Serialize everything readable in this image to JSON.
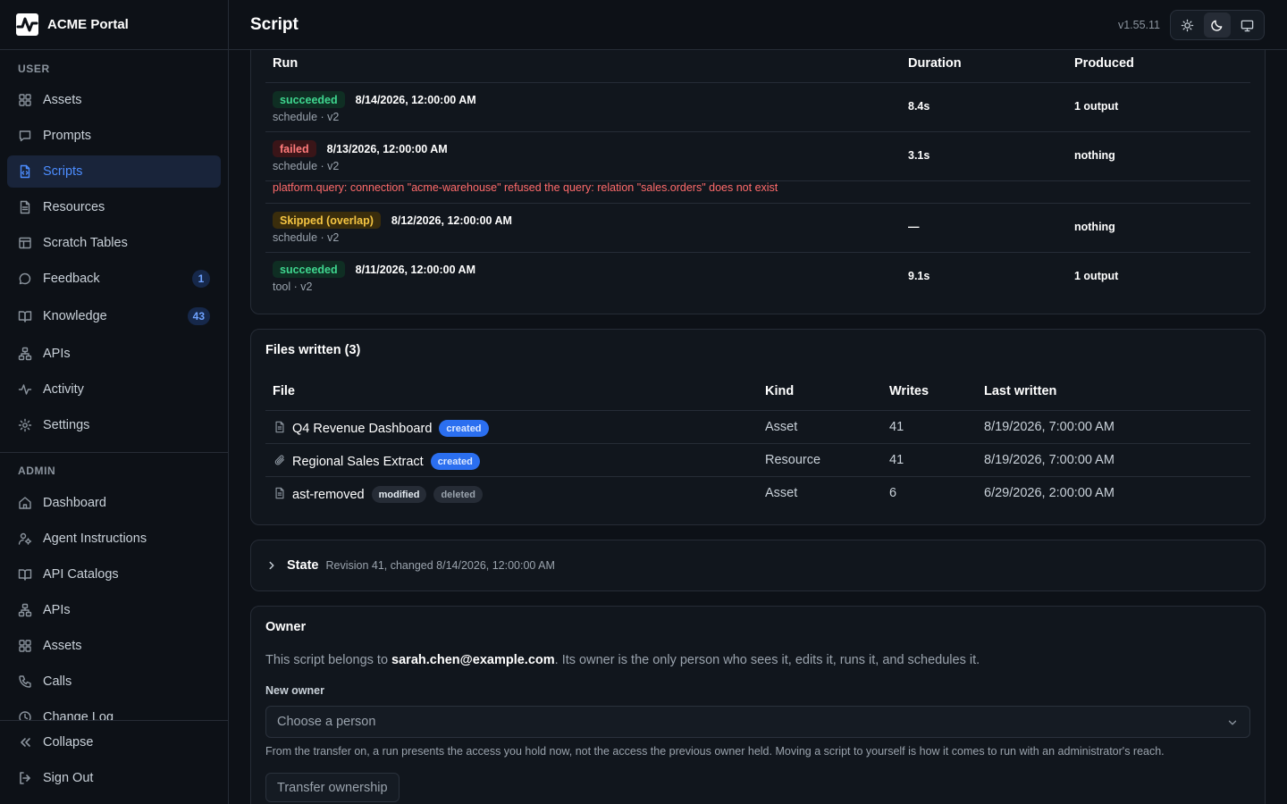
{
  "app": {
    "name": "ACME Portal",
    "version": "v1.55.11"
  },
  "header": {
    "title": "Script"
  },
  "sidebar": {
    "user_label": "USER",
    "user_items": [
      {
        "label": "Assets",
        "icon": "grid-icon"
      },
      {
        "label": "Prompts",
        "icon": "message-square-icon"
      },
      {
        "label": "Scripts",
        "icon": "file-code-icon",
        "active": true
      },
      {
        "label": "Resources",
        "icon": "file-text-icon"
      },
      {
        "label": "Scratch Tables",
        "icon": "table-icon"
      },
      {
        "label": "Feedback",
        "icon": "message-circle-icon",
        "badge": "1"
      },
      {
        "label": "Knowledge",
        "icon": "book-open-icon",
        "badge": "43"
      },
      {
        "label": "APIs",
        "icon": "network-icon"
      },
      {
        "label": "Activity",
        "icon": "activity-icon"
      },
      {
        "label": "Settings",
        "icon": "gear-icon"
      }
    ],
    "admin_label": "ADMIN",
    "admin_items": [
      {
        "label": "Dashboard",
        "icon": "home-icon"
      },
      {
        "label": "Agent Instructions",
        "icon": "user-cog-icon"
      },
      {
        "label": "API Catalogs",
        "icon": "book-open-icon"
      },
      {
        "label": "APIs",
        "icon": "network-icon"
      },
      {
        "label": "Assets",
        "icon": "grid-icon"
      },
      {
        "label": "Calls",
        "icon": "phone-icon"
      },
      {
        "label": "Change Log",
        "icon": "clock-icon"
      }
    ],
    "collapse": "Collapse",
    "sign_out": "Sign Out"
  },
  "runs": {
    "headers": {
      "run": "Run",
      "duration": "Duration",
      "produced": "Produced"
    },
    "rows": [
      {
        "status": "succeeded",
        "status_kind": "ok",
        "date": "8/14/2026, 12:00:00 AM",
        "sub": "schedule · v2",
        "duration": "8.4s",
        "produced": "1 output"
      },
      {
        "status": "failed",
        "status_kind": "fail",
        "date": "8/13/2026, 12:00:00 AM",
        "sub": "schedule · v2",
        "duration": "3.1s",
        "produced": "nothing",
        "error": "platform.query: connection \"acme-warehouse\" refused the query: relation \"sales.orders\" does not exist"
      },
      {
        "status": "Skipped (overlap)",
        "status_kind": "skip",
        "date": "8/12/2026, 12:00:00 AM",
        "sub": "schedule · v2",
        "duration": "—",
        "produced": "nothing"
      },
      {
        "status": "succeeded",
        "status_kind": "ok",
        "date": "8/11/2026, 12:00:00 AM",
        "sub": "tool · v2",
        "duration": "9.1s",
        "produced": "1 output"
      }
    ]
  },
  "files": {
    "title": "Files written (3)",
    "headers": {
      "file": "File",
      "kind": "Kind",
      "writes": "Writes",
      "last_written": "Last written"
    },
    "rows": [
      {
        "name": "Q4 Revenue Dashboard",
        "icon": "file-icon",
        "tags": [
          "created"
        ],
        "kind": "Asset",
        "writes": "41",
        "last_written": "8/19/2026, 7:00:00 AM"
      },
      {
        "name": "Regional Sales Extract",
        "icon": "paperclip-icon",
        "tags": [
          "created"
        ],
        "kind": "Resource",
        "writes": "41",
        "last_written": "8/19/2026, 7:00:00 AM"
      },
      {
        "name": "ast-removed",
        "icon": "file-icon",
        "tags": [
          "modified",
          "deleted"
        ],
        "kind": "Asset",
        "writes": "6",
        "last_written": "6/29/2026, 2:00:00 AM"
      }
    ]
  },
  "state": {
    "label": "State",
    "meta": "Revision 41, changed 8/14/2026, 12:00:00 AM"
  },
  "owner": {
    "title": "Owner",
    "desc_prefix": "This script belongs to ",
    "email": "sarah.chen@example.com",
    "desc_suffix": ". Its owner is the only person who sees it, edits it, runs it, and schedules it.",
    "field_label": "New owner",
    "placeholder": "Choose a person",
    "help": "From the transfer on, a run presents the access you hold now, not the access the previous owner held. Moving a script to yourself is how it comes to run with an administrator's reach.",
    "button": "Transfer ownership"
  },
  "colors": {
    "accent": "#4c8dff",
    "success": "#3fd68f",
    "danger": "#ff7b7b",
    "warning": "#f5c542",
    "created_tag": "#2b6ff0"
  }
}
